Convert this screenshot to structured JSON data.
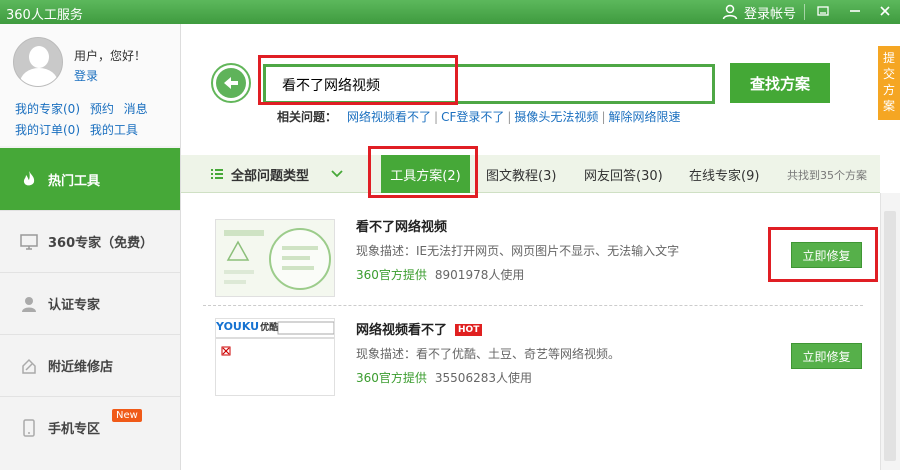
{
  "window": {
    "title": "360人工服务",
    "login_label": "登录帐号"
  },
  "profile": {
    "greeting": "用户，您好！",
    "login_link": "登录",
    "links_row1": [
      "我的专家(0)",
      "预约",
      "消息"
    ],
    "links_row2": [
      "我的订单(0)",
      "我的工具"
    ]
  },
  "sidebar": {
    "items": [
      {
        "label": "热门工具",
        "icon": "flame-icon",
        "active": true
      },
      {
        "label": "360专家（免费）",
        "icon": "monitor-icon",
        "active": false
      },
      {
        "label": "认证专家",
        "icon": "person-icon",
        "active": false
      },
      {
        "label": "附近维修店",
        "icon": "wrench-icon",
        "active": false
      },
      {
        "label": "手机专区",
        "icon": "phone-icon",
        "active": false,
        "badge": "New"
      }
    ]
  },
  "search": {
    "value": "看不了网络视频",
    "button_label": "查找方案"
  },
  "side_tab": {
    "label": "提交方案"
  },
  "related": {
    "label": "相关问题：",
    "links": [
      "网络视频看不了",
      "CF登录不了",
      "摄像头无法视频",
      "解除网络限速"
    ]
  },
  "tabs": {
    "all_types": "全部问题类型",
    "items": [
      "工具方案(2)",
      "图文教程(3)",
      "网友回答(30)",
      "在线专家(9)"
    ],
    "count_text": "共找到35个方案"
  },
  "results": [
    {
      "title": "看不了网络视频",
      "desc": "现象描述：IE无法打开网页、网页图片不显示、无法输入文字",
      "provider": "360官方提供",
      "users": "8901978人使用",
      "button": "立即修复"
    },
    {
      "title": "网络视频看不了",
      "hot": "HOT",
      "desc": "现象描述：看不了优酷、土豆、奇艺等网络视频。",
      "provider": "360官方提供",
      "users": "35506283人使用",
      "button": "立即修复",
      "thumb_brand": "YOUKU",
      "thumb_brand_cn": "优酷"
    }
  ],
  "colors": {
    "brand_green": "#46a838",
    "highlight_red": "#e01e24",
    "submit_orange": "#f5a623"
  }
}
